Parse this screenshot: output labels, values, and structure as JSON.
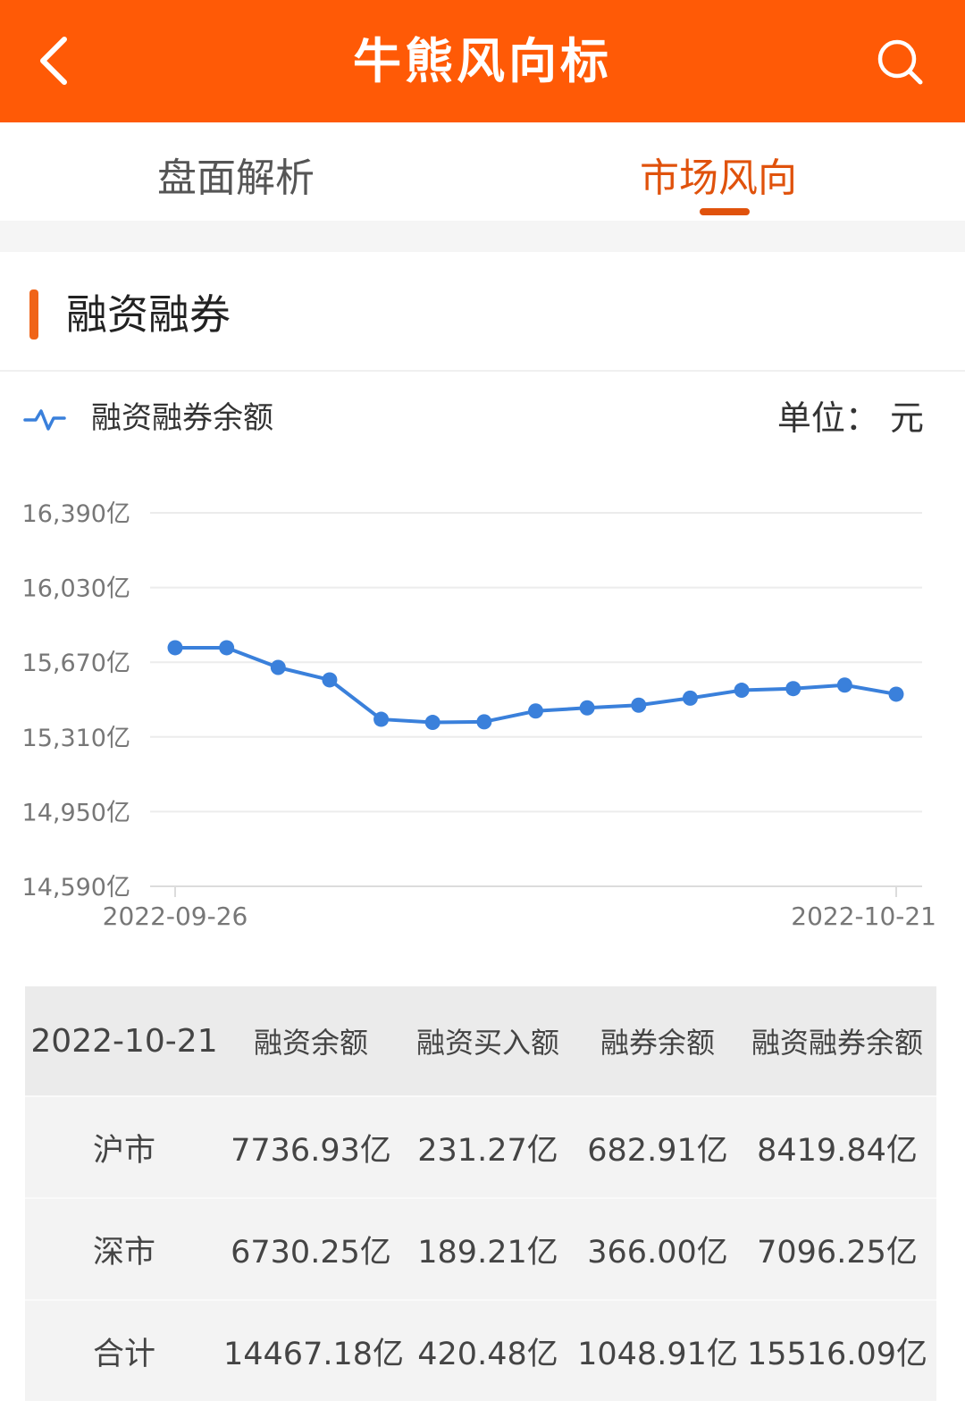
{
  "header": {
    "title": "牛熊风向标",
    "back_icon": "chevron-left-icon",
    "search_icon": "search-icon",
    "bg_color": "#ff5a06"
  },
  "tabs": [
    {
      "label": "盘面解析",
      "active": false
    },
    {
      "label": "市场风向",
      "active": true
    }
  ],
  "section": {
    "title": "融资融券",
    "legend_label": "融资融券余额",
    "unit_label": "单位：  元"
  },
  "chart_data": {
    "type": "line",
    "series": [
      {
        "name": "融资融券余额",
        "color": "#3a80db",
        "values": [
          15740,
          15740,
          15645,
          15585,
          15395,
          15380,
          15383,
          15435,
          15450,
          15463,
          15497,
          15535,
          15543,
          15560,
          15516.09
        ]
      }
    ],
    "x_start_label": "2022-09-26",
    "x_end_label": "2022-10-21",
    "ylim": [
      14590,
      16390
    ],
    "y_ticks": [
      {
        "value": 16390,
        "label": "16,390亿"
      },
      {
        "value": 16030,
        "label": "16,030亿"
      },
      {
        "value": 15670,
        "label": "15,670亿"
      },
      {
        "value": 15310,
        "label": "15,310亿"
      },
      {
        "value": 14950,
        "label": "14,950亿"
      },
      {
        "value": 14590,
        "label": "14,590亿"
      }
    ],
    "grid": true
  },
  "table": {
    "headers": [
      "2022-10-21",
      "融资余额",
      "融资买入额",
      "融券余额",
      "融资融券余额"
    ],
    "rows": [
      [
        "沪市",
        "7736.93亿",
        "231.27亿",
        "682.91亿",
        "8419.84亿"
      ],
      [
        "深市",
        "6730.25亿",
        "189.21亿",
        "366.00亿",
        "7096.25亿"
      ],
      [
        "合计",
        "14467.18亿",
        "420.48亿",
        "1048.91亿",
        "15516.09亿"
      ]
    ]
  }
}
